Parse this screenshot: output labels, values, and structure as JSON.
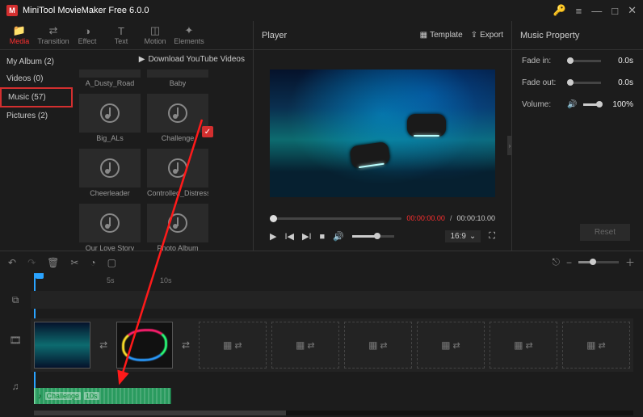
{
  "app": {
    "title": "MiniTool MovieMaker Free 6.0.0",
    "logo_letter": "M"
  },
  "win": {
    "min": "—",
    "max": "□",
    "close": "✕",
    "menu": "≡"
  },
  "toolbar": [
    {
      "name": "media",
      "label": "Media",
      "icon": "📁",
      "active": true
    },
    {
      "name": "transition",
      "label": "Transition",
      "icon": "⇄"
    },
    {
      "name": "effect",
      "label": "Effect",
      "icon": "◑"
    },
    {
      "name": "text",
      "label": "Text",
      "icon": "T"
    },
    {
      "name": "motion",
      "label": "Motion",
      "icon": "◫"
    },
    {
      "name": "elements",
      "label": "Elements",
      "icon": "✦"
    }
  ],
  "sidebar": [
    {
      "label": "My Album (2)"
    },
    {
      "label": "Videos (0)"
    },
    {
      "label": "Music (57)",
      "highlight": true
    },
    {
      "label": "Pictures (2)"
    }
  ],
  "download_label": "Download YouTube Videos",
  "grid": [
    {
      "label": "A_Dusty_Road",
      "half": true
    },
    {
      "label": "Baby",
      "half": true
    },
    {
      "label": "Big_ALs"
    },
    {
      "label": "Challenge",
      "checked": true
    },
    {
      "label": "Cheerleader"
    },
    {
      "label": "Controlled_Distress"
    },
    {
      "label": "Our Love Story",
      "nolabelOnly": false
    },
    {
      "label": "Photo Album"
    }
  ],
  "player": {
    "title": "Player",
    "template": "Template",
    "export": "Export",
    "time_current": "00:00:00.00",
    "time_total": "00:00:10.00",
    "aspect": "16:9"
  },
  "props": {
    "title": "Music Property",
    "fade_in": {
      "label": "Fade in:",
      "value": "0.0s"
    },
    "fade_out": {
      "label": "Fade out:",
      "value": "0.0s"
    },
    "volume": {
      "label": "Volume:",
      "value": "100%"
    },
    "reset": "Reset"
  },
  "ruler": {
    "t1": "5s",
    "t2": "10s"
  },
  "audio_clip": {
    "label": "Challenge",
    "dur": "10s"
  }
}
